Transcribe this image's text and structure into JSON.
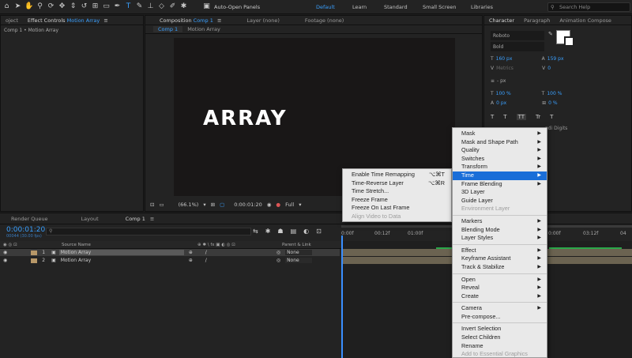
{
  "toolbar": {
    "auto_open": "Auto-Open Panels",
    "workspaces": [
      "Default",
      "Learn",
      "Standard",
      "Small Screen",
      "Libraries"
    ],
    "help_placeholder": "Search Help"
  },
  "left_panel": {
    "tab_project": "oject",
    "tab_effect_controls": "Effect Controls",
    "tab_effect_target": "Motion Array",
    "breadcrumb": "Comp 1 • Motion Array"
  },
  "viewer": {
    "tab_composition": "Composition",
    "tab_comp_name": "Comp 1",
    "tab_layer": "Layer (none)",
    "tab_footage": "Footage (none)",
    "sub_tabs": [
      "Comp 1",
      "Motion Array"
    ],
    "title_text": "ARRAY",
    "zoom": "(66.1%)",
    "timecode": "0:00:01:20",
    "resolution": "Full"
  },
  "character": {
    "tabs": [
      "Character",
      "Paragraph",
      "Animation Compose"
    ],
    "font": "Roboto",
    "style": "Bold",
    "size": "160 px",
    "leading": "159 px",
    "kerning": "Metrics",
    "tracking": "0",
    "stroke": "- px",
    "vscale": "100 %",
    "hscale": "100 %",
    "baseline": "0 px",
    "tsume": "0 %",
    "style_buttons": [
      "T",
      "T",
      "TT",
      "Tr",
      "T"
    ],
    "digits": "ndi Digits"
  },
  "timeline": {
    "tabs": [
      "Render Queue",
      "Layout",
      "Comp 1"
    ],
    "timecode": "0:00:01:20",
    "frames": "00044 (30.00 fps)",
    "col_source": "Source Name",
    "col_parent": "Parent & Link",
    "layers": [
      {
        "num": "1",
        "name": "Motion Array",
        "parent": "None"
      },
      {
        "num": "2",
        "name": "Motion Array",
        "parent": "None"
      }
    ],
    "ruler_ticks": [
      "0:00f",
      "00:12f",
      "01:00f",
      "0:00f",
      "03:12f",
      "04"
    ]
  },
  "context_menu": {
    "items": [
      {
        "label": "Mask",
        "arrow": true
      },
      {
        "label": "Mask and Shape Path",
        "arrow": true
      },
      {
        "label": "Quality",
        "arrow": true
      },
      {
        "label": "Switches",
        "arrow": true
      },
      {
        "label": "Transform",
        "arrow": true
      },
      {
        "label": "Time",
        "arrow": true,
        "highlight": true
      },
      {
        "label": "Frame Blending",
        "arrow": true
      },
      {
        "label": "3D Layer",
        "arrow": false
      },
      {
        "label": "Guide Layer",
        "arrow": false
      },
      {
        "label": "Environment Layer",
        "arrow": false,
        "disabled": true
      },
      {
        "sep": true
      },
      {
        "label": "Markers",
        "arrow": true
      },
      {
        "label": "Blending Mode",
        "arrow": true
      },
      {
        "label": "Layer Styles",
        "arrow": true
      },
      {
        "sep": true
      },
      {
        "label": "Effect",
        "arrow": true
      },
      {
        "label": "Keyframe Assistant",
        "arrow": true
      },
      {
        "label": "Track & Stabilize",
        "arrow": true
      },
      {
        "sep": true
      },
      {
        "label": "Open",
        "arrow": true
      },
      {
        "label": "Reveal",
        "arrow": true
      },
      {
        "label": "Create",
        "arrow": true
      },
      {
        "sep": true
      },
      {
        "label": "Camera",
        "arrow": true
      },
      {
        "label": "Pre-compose...",
        "arrow": false
      },
      {
        "sep": true
      },
      {
        "label": "Invert Selection",
        "arrow": false
      },
      {
        "label": "Select Children",
        "arrow": false
      },
      {
        "label": "Rename",
        "arrow": false
      },
      {
        "label": "Add to Essential Graphics",
        "arrow": false,
        "disabled": true
      }
    ]
  },
  "time_submenu": {
    "items": [
      {
        "label": "Enable Time Remapping",
        "shortcut": "⌥⌘T"
      },
      {
        "label": "Time-Reverse Layer",
        "shortcut": "⌥⌘R"
      },
      {
        "label": "Time Stretch...",
        "shortcut": ""
      },
      {
        "label": "Freeze Frame",
        "shortcut": ""
      },
      {
        "label": "Freeze On Last Frame",
        "shortcut": ""
      },
      {
        "label": "Align Video to Data",
        "shortcut": "",
        "disabled": true
      }
    ]
  }
}
